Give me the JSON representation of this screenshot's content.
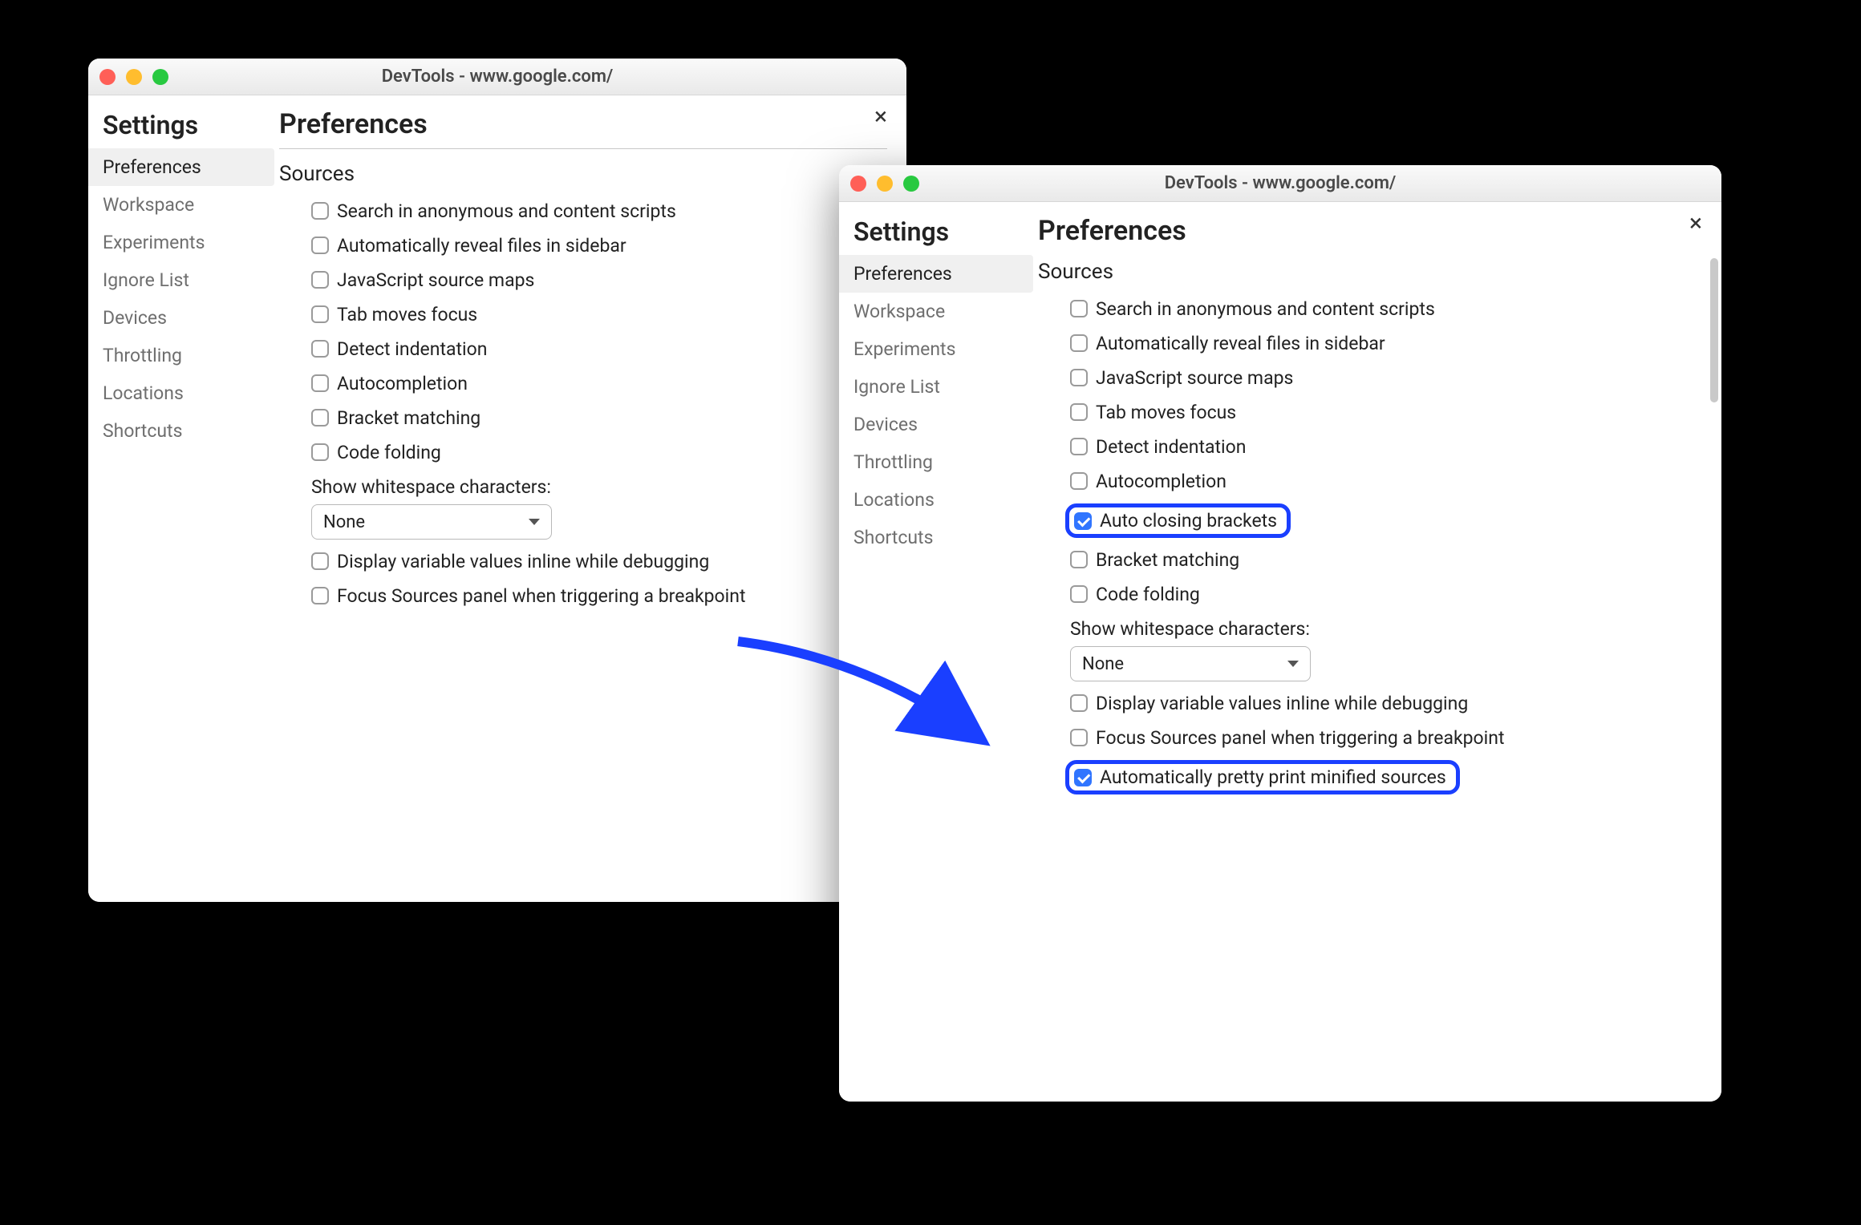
{
  "window1": {
    "title": "DevTools - www.google.com/",
    "sidebar_title": "Settings",
    "sidebar_items": [
      "Preferences",
      "Workspace",
      "Experiments",
      "Ignore List",
      "Devices",
      "Throttling",
      "Locations",
      "Shortcuts"
    ],
    "sidebar_active": 0,
    "main_title": "Preferences",
    "section": "Sources",
    "options": [
      {
        "label": "Search in anonymous and content scripts",
        "checked": false
      },
      {
        "label": "Automatically reveal files in sidebar",
        "checked": false
      },
      {
        "label": "JavaScript source maps",
        "checked": false
      },
      {
        "label": "Tab moves focus",
        "checked": false
      },
      {
        "label": "Detect indentation",
        "checked": false
      },
      {
        "label": "Autocompletion",
        "checked": false
      },
      {
        "label": "Bracket matching",
        "checked": false
      },
      {
        "label": "Code folding",
        "checked": false
      }
    ],
    "select_label": "Show whitespace characters:",
    "select_value": "None",
    "extra": [
      {
        "label": "Display variable values inline while debugging",
        "checked": false
      },
      {
        "label": "Focus Sources panel when triggering a breakpoint",
        "checked": false
      }
    ]
  },
  "window2": {
    "title": "DevTools - www.google.com/",
    "sidebar_title": "Settings",
    "sidebar_items": [
      "Preferences",
      "Workspace",
      "Experiments",
      "Ignore List",
      "Devices",
      "Throttling",
      "Locations",
      "Shortcuts"
    ],
    "sidebar_active": 0,
    "main_title": "Preferences",
    "section": "Sources",
    "options": [
      {
        "label": "Search in anonymous and content scripts",
        "checked": false
      },
      {
        "label": "Automatically reveal files in sidebar",
        "checked": false
      },
      {
        "label": "JavaScript source maps",
        "checked": false
      },
      {
        "label": "Tab moves focus",
        "checked": false
      },
      {
        "label": "Detect indentation",
        "checked": false
      },
      {
        "label": "Autocompletion",
        "checked": false
      },
      {
        "label": "Auto closing brackets",
        "checked": true,
        "highlighted": true
      },
      {
        "label": "Bracket matching",
        "checked": false
      },
      {
        "label": "Code folding",
        "checked": false
      }
    ],
    "select_label": "Show whitespace characters:",
    "select_value": "None",
    "extra": [
      {
        "label": "Display variable values inline while debugging",
        "checked": false
      },
      {
        "label": "Focus Sources panel when triggering a breakpoint",
        "checked": false
      },
      {
        "label": "Automatically pretty print minified sources",
        "checked": true,
        "highlighted": true
      }
    ]
  },
  "colors": {
    "highlight_border": "#1a3fff",
    "checkbox_checked": "#3075ff"
  }
}
